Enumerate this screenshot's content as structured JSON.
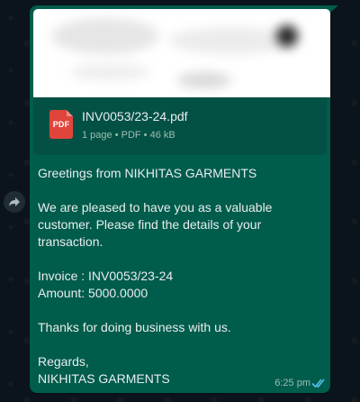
{
  "colors": {
    "bubble": "#005c4b",
    "file_card": "#025144",
    "pdf_icon": "#e0453c",
    "text": "#e9edef",
    "meta_text": "#9fbcb4",
    "read_tick": "#53bdeb",
    "background": "#0b141a"
  },
  "attachment": {
    "icon": "pdf-icon",
    "icon_label": "PDF",
    "file_name": "INV0053/23-24.pdf",
    "meta": "1 page • PDF • 46 kB"
  },
  "message": {
    "lines": [
      "Greetings from NIKHITAS GARMENTS",
      "We are pleased to have you as a valuable",
      "customer. Please find the details of your",
      "transaction.",
      "Invoice : INV0053/23-24",
      "Amount: 5000.0000",
      "Thanks for doing business with us.",
      "Regards,",
      "NIKHITAS GARMENTS"
    ],
    "time": "6:25 pm",
    "status_icon": "double-check-read-icon"
  },
  "forward": {
    "icon": "forward-arrow-icon"
  }
}
